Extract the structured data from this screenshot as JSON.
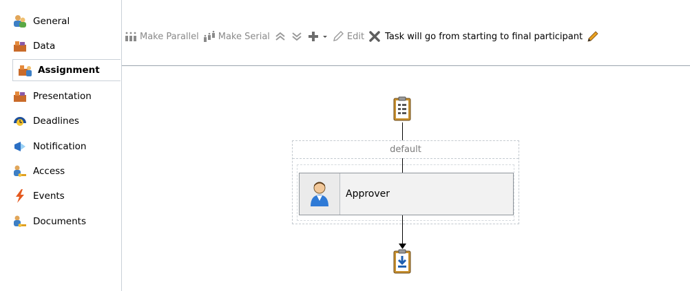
{
  "sidebar": {
    "items": [
      {
        "label": "General",
        "icon": "users-general-icon",
        "selected": false
      },
      {
        "label": "Data",
        "icon": "data-blocks-icon",
        "selected": false
      },
      {
        "label": "Assignment",
        "icon": "assignment-icon",
        "selected": true
      },
      {
        "label": "Presentation",
        "icon": "presentation-icon",
        "selected": false
      },
      {
        "label": "Deadlines",
        "icon": "deadlines-clock-icon",
        "selected": false
      },
      {
        "label": "Notification",
        "icon": "notification-megaphone-icon",
        "selected": false
      },
      {
        "label": "Access",
        "icon": "access-key-icon",
        "selected": false
      },
      {
        "label": "Events",
        "icon": "lightning-icon",
        "selected": false
      },
      {
        "label": "Documents",
        "icon": "documents-key-icon",
        "selected": false
      }
    ]
  },
  "toolbar": {
    "make_parallel": "Make Parallel",
    "make_serial": "Make Serial",
    "edit": "Edit",
    "task_flow": "Task will go from starting to final participant"
  },
  "canvas": {
    "group_label": "default",
    "participant_label": "Approver"
  },
  "colors": {
    "border": "#c9d0d8",
    "toolbar_divider": "#9aa3ad",
    "disabled_text": "#8a8a8a",
    "participant_bg": "#f2f2f2",
    "task_icon_bg": "#c8902e"
  }
}
